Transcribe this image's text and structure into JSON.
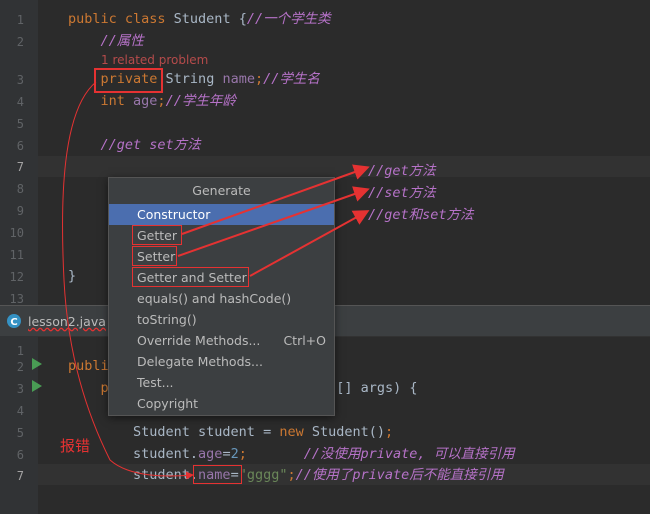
{
  "top_editor": {
    "lines": [
      {
        "num": "1",
        "parts": [
          {
            "t": "public class ",
            "c": "kw"
          },
          {
            "t": "Student {",
            "c": ""
          },
          {
            "t": "//一个学生类",
            "c": "cm"
          }
        ]
      },
      {
        "num": "2",
        "parts": [
          {
            "t": "    //属性",
            "c": "cm"
          }
        ]
      },
      {
        "num": "3",
        "parts": [
          {
            "t": "    ",
            "c": ""
          },
          {
            "t": "private",
            "c": "kw"
          },
          {
            "t": " String ",
            "c": ""
          },
          {
            "t": "name",
            "c": "fld"
          },
          {
            "t": ";",
            "c": "kw"
          },
          {
            "t": "//学生名",
            "c": "cm"
          }
        ]
      },
      {
        "num": "4",
        "parts": [
          {
            "t": "    ",
            "c": ""
          },
          {
            "t": "int ",
            "c": "kw"
          },
          {
            "t": "age",
            "c": "fld"
          },
          {
            "t": ";",
            "c": "kw"
          },
          {
            "t": "//学生年龄",
            "c": "cm"
          }
        ]
      },
      {
        "num": "5",
        "parts": []
      },
      {
        "num": "6",
        "parts": [
          {
            "t": "    //get set方法",
            "c": "cm"
          }
        ]
      },
      {
        "num": "7",
        "parts": []
      },
      {
        "num": "8",
        "parts": []
      },
      {
        "num": "9",
        "parts": []
      },
      {
        "num": "10",
        "parts": []
      },
      {
        "num": "11",
        "parts": []
      },
      {
        "num": "12",
        "parts": [
          {
            "t": "}",
            "c": ""
          }
        ]
      },
      {
        "num": "13",
        "parts": []
      }
    ],
    "inlay_hint": "1 related problem"
  },
  "tab": {
    "label": "lesson2.java"
  },
  "bottom_editor": {
    "lines": [
      {
        "num": "1",
        "parts": []
      },
      {
        "num": "2",
        "parts": [
          {
            "t": "publi",
            "c": "kw"
          }
        ]
      },
      {
        "num": "3",
        "parts": [
          {
            "t": "    p",
            "c": "kw"
          },
          {
            "t": "                          ng[] args) {",
            "c": ""
          }
        ]
      },
      {
        "num": "4",
        "parts": []
      },
      {
        "num": "5",
        "parts": [
          {
            "t": "        Student student = ",
            "c": ""
          },
          {
            "t": "new ",
            "c": "kw"
          },
          {
            "t": "Student()",
            "c": ""
          },
          {
            "t": ";",
            "c": "kw"
          }
        ]
      },
      {
        "num": "6",
        "parts": [
          {
            "t": "        student.",
            "c": ""
          },
          {
            "t": "age",
            "c": "fld"
          },
          {
            "t": "=",
            "c": ""
          },
          {
            "t": "2",
            "c": "num"
          },
          {
            "t": ";",
            "c": "kw"
          },
          {
            "t": "       //没使用private, 可以直接引用",
            "c": "cm"
          }
        ]
      },
      {
        "num": "7",
        "parts": [
          {
            "t": "        student.",
            "c": ""
          },
          {
            "t": "name",
            "c": "fld"
          },
          {
            "t": "=",
            "c": ""
          },
          {
            "t": "\"gggg\"",
            "c": "str"
          },
          {
            "t": ";",
            "c": "kw"
          },
          {
            "t": "//使用了private后不能直接引用",
            "c": "cm"
          }
        ]
      }
    ]
  },
  "popup": {
    "title": "Generate",
    "items": [
      {
        "label": "Constructor",
        "shortcut": ""
      },
      {
        "label": "Getter",
        "shortcut": ""
      },
      {
        "label": "Setter",
        "shortcut": ""
      },
      {
        "label": "Getter and Setter",
        "shortcut": ""
      },
      {
        "label": "equals() and hashCode()",
        "shortcut": ""
      },
      {
        "label": "toString()",
        "shortcut": ""
      },
      {
        "label": "Override Methods...",
        "shortcut": "Ctrl+O"
      },
      {
        "label": "Delegate Methods...",
        "shortcut": ""
      },
      {
        "label": "Test...",
        "shortcut": ""
      },
      {
        "label": "Copyright",
        "shortcut": ""
      }
    ]
  },
  "annotations": {
    "get": "//get方法",
    "set": "//set方法",
    "getset": "//get和set方法",
    "error": "报错"
  },
  "colors": {
    "accent_selection": "#4b6eaf",
    "annotation_red": "#e53232",
    "comment": "#b672c8",
    "keyword": "#cc7832"
  }
}
